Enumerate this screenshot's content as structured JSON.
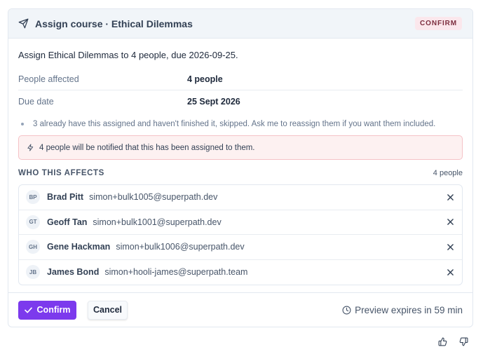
{
  "header": {
    "title": "Assign course · Ethical Dilemmas",
    "badge": "CONFIRM",
    "icon": "send-icon"
  },
  "summary": "Assign Ethical Dilemmas to 4 people, due 2026-09-25.",
  "details": [
    {
      "label": "People affected",
      "value": "4 people"
    },
    {
      "label": "Due date",
      "value": "25 Sept 2026"
    }
  ],
  "note": "3 already have this assigned and haven't finished it, skipped. Ask me to reassign them if you want them included.",
  "alert": {
    "text": "4 people will be notified that this has been assigned to them.",
    "icon": "lightning-icon"
  },
  "affects": {
    "title": "WHO THIS AFFECTS",
    "count": "4 people",
    "people": [
      {
        "initials": "BP",
        "name": "Brad Pitt",
        "email": "simon+bulk1005@superpath.dev"
      },
      {
        "initials": "GT",
        "name": "Geoff Tan",
        "email": "simon+bulk1001@superpath.dev"
      },
      {
        "initials": "GH",
        "name": "Gene Hackman",
        "email": "simon+bulk1006@superpath.dev"
      },
      {
        "initials": "JB",
        "name": "James Bond",
        "email": "simon+hooli-james@superpath.team"
      }
    ]
  },
  "footer": {
    "confirm_label": "Confirm",
    "cancel_label": "Cancel",
    "expires": "Preview expires in 59 min"
  },
  "colors": {
    "accent": "#7c3aed",
    "alert_bg": "#fdf1f1",
    "alert_border": "#f5c2c7",
    "badge_bg": "#fbe7ec"
  }
}
